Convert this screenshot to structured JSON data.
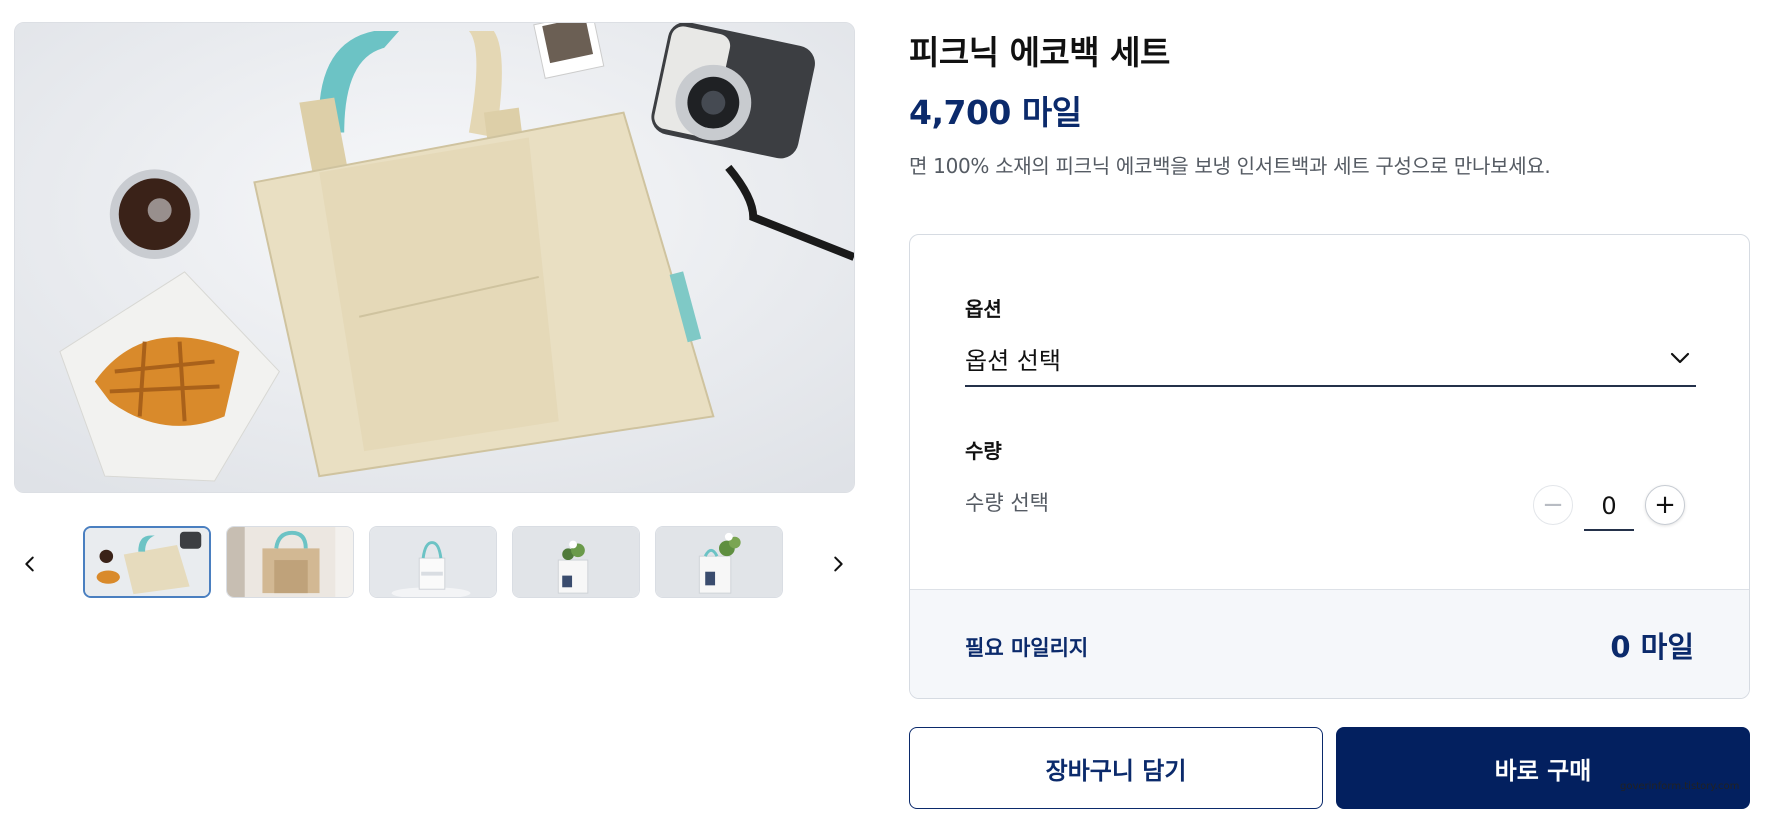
{
  "product": {
    "title": "피크닉 에코백 세트",
    "price": "4,700 마일",
    "description": "면 100% 소재의 피크닉 에코백을 보냉 인서트백과 세트 구성으로 만나보세요."
  },
  "gallery": {
    "main_image": "tote-bag-picnic-photo",
    "prev_icon": "chevron-left-icon",
    "next_icon": "chevron-right-icon",
    "thumbnails": [
      {
        "image": "picnic-tote-flatlay",
        "active": true
      },
      {
        "image": "tote-with-insert-bag",
        "active": false
      },
      {
        "image": "white-tote-teal-handle",
        "active": false
      },
      {
        "image": "white-tote-with-flowers",
        "active": false
      },
      {
        "image": "white-tote-with-flowers-angle",
        "active": false
      }
    ]
  },
  "options": {
    "option_label": "옵션",
    "option_placeholder": "옵션 선택",
    "quantity_label": "수량",
    "quantity_hint": "수량 선택",
    "quantity_value": "0",
    "minus_symbol": "−",
    "plus_symbol": "+",
    "mileage_label": "필요 마일리지",
    "mileage_value": "0 마일"
  },
  "actions": {
    "cart_label": "장바구니 담기",
    "buy_label": "바로 구매"
  },
  "watermark": "goverinform.tistory.com",
  "colors": {
    "navy": "#0b2a6b",
    "button_navy": "#03205f",
    "active_thumb_border": "#4a7fc0",
    "panel_bg": "#f5f7fa"
  }
}
